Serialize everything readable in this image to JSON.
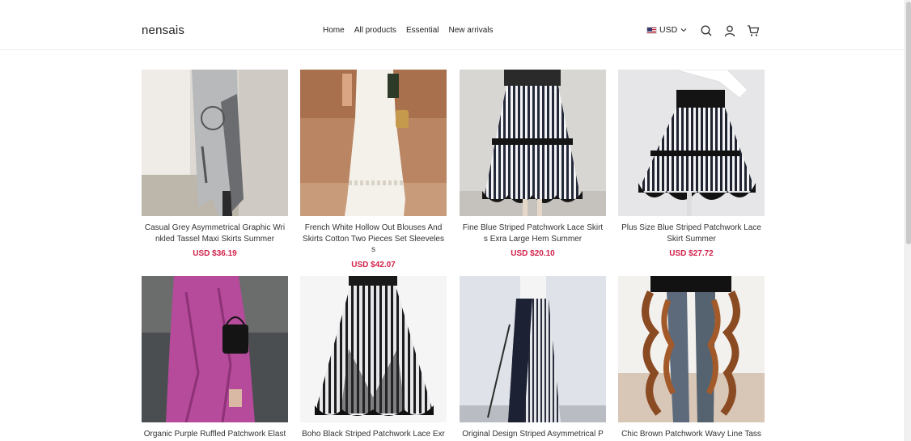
{
  "header": {
    "logo": "nensais",
    "nav": [
      "Home",
      "All products",
      "Essential",
      "New arrivals"
    ],
    "currency": "USD",
    "icons": [
      "us-flag-icon",
      "chevron-down-icon",
      "search-icon",
      "user-icon",
      "cart-icon"
    ]
  },
  "colors": {
    "price": "#d1224a",
    "text": "#333333",
    "border": "#eeeeee"
  },
  "products": [
    {
      "title": "Casual Grey Asymmetrical Graphic Wrinkled Tassel Maxi Skirts Summer",
      "price": "USD $36.19"
    },
    {
      "title": "French White Hollow Out Blouses And Skirts Cotton Two Pieces Set Sleeveless",
      "price": "USD $42.07"
    },
    {
      "title": "Fine Blue Striped Patchwork Lace Skirts Exra Large Hem Summer",
      "price": "USD $20.10"
    },
    {
      "title": "Plus Size Blue Striped Patchwork Lace Skirt Summer",
      "price": "USD $27.72"
    },
    {
      "title": "Organic Purple Ruffled Patchwork Elastic",
      "price": ""
    },
    {
      "title": "Boho Black Striped Patchwork Lace Exra",
      "price": ""
    },
    {
      "title": "Original Design Striped Asymmetrical P",
      "price": ""
    },
    {
      "title": "Chic Brown Patchwork Wavy Line Tassel",
      "price": ""
    }
  ]
}
